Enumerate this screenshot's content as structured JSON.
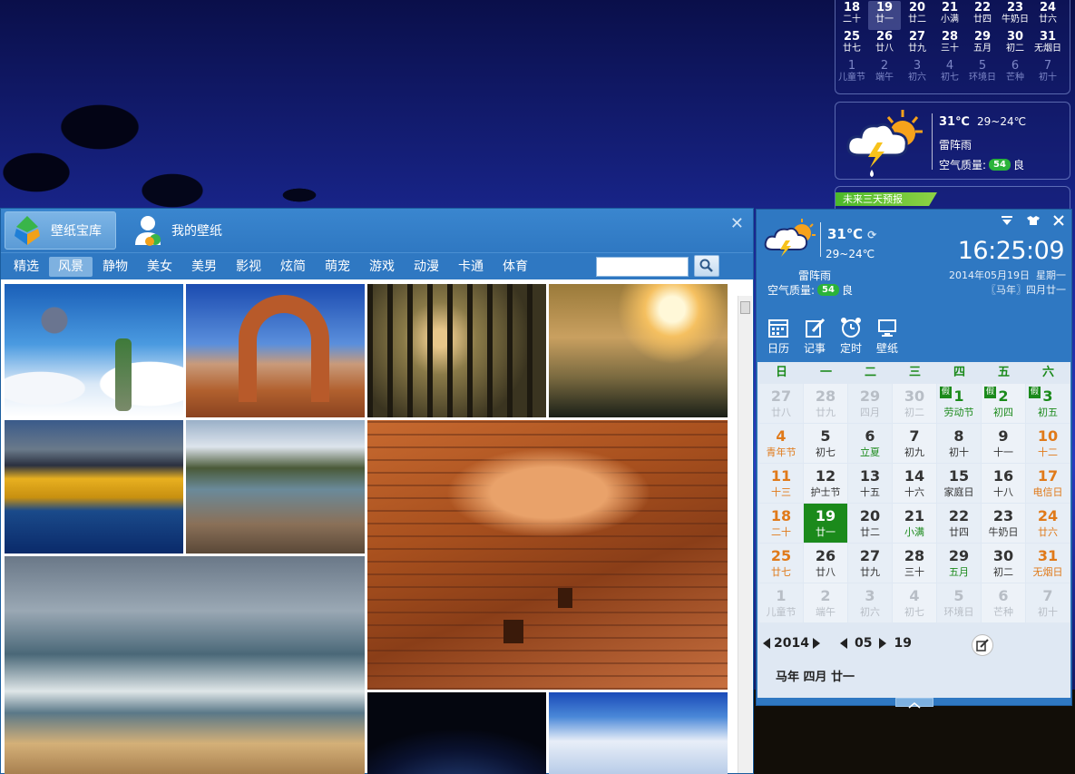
{
  "desktop_calendar": {
    "rows": [
      [
        {
          "n": "18",
          "s": "二十"
        },
        {
          "n": "19",
          "s": "廿一",
          "today": true
        },
        {
          "n": "20",
          "s": "廿二"
        },
        {
          "n": "21",
          "s": "小满"
        },
        {
          "n": "22",
          "s": "廿四"
        },
        {
          "n": "23",
          "s": "牛奶日"
        },
        {
          "n": "24",
          "s": "廿六"
        }
      ],
      [
        {
          "n": "25",
          "s": "廿七"
        },
        {
          "n": "26",
          "s": "廿八"
        },
        {
          "n": "27",
          "s": "廿九"
        },
        {
          "n": "28",
          "s": "三十"
        },
        {
          "n": "29",
          "s": "五月"
        },
        {
          "n": "30",
          "s": "初二"
        },
        {
          "n": "31",
          "s": "无烟日"
        }
      ],
      [
        {
          "n": "1",
          "s": "儿童节",
          "muted": true
        },
        {
          "n": "2",
          "s": "端午",
          "muted": true
        },
        {
          "n": "3",
          "s": "初六",
          "muted": true
        },
        {
          "n": "4",
          "s": "初七",
          "muted": true
        },
        {
          "n": "5",
          "s": "环境日",
          "muted": true
        },
        {
          "n": "6",
          "s": "芒种",
          "muted": true
        },
        {
          "n": "7",
          "s": "初十",
          "muted": true
        }
      ]
    ]
  },
  "desktop_weather": {
    "temp": "31℃",
    "range": "29~24℃",
    "condition": "雷阵雨",
    "aq_label": "空气质量:",
    "aqi": "54",
    "aq_level": "良"
  },
  "desktop_forecast": {
    "label": "未来三天预报"
  },
  "wallpaper": {
    "tab_library": "壁纸宝库",
    "tab_mine": "我的壁纸",
    "categories": [
      "精选",
      "风景",
      "静物",
      "美女",
      "美男",
      "影视",
      "炫简",
      "萌宠",
      "游戏",
      "动漫",
      "卡通",
      "体育"
    ],
    "selected_category": "风景",
    "search_value": ""
  },
  "calendar": {
    "temp": "31℃",
    "range": "29~24℃",
    "clock": "16:25:09",
    "condition": "雷阵雨",
    "aq_label": "空气质量:",
    "aqi": "54",
    "aq_level": "良",
    "date": "2014年05月19日",
    "weekday": "星期一",
    "lunar": "〖马年〗四月廿一",
    "tools": [
      "日历",
      "记事",
      "定时",
      "壁纸"
    ],
    "weekdays": [
      "日",
      "一",
      "二",
      "三",
      "四",
      "五",
      "六"
    ],
    "year": "2014",
    "month": "05",
    "day": "19",
    "lunar_line": "马年 四月 廿一",
    "holiday_mark": "假",
    "colors": {
      "accent": "#2f78c2",
      "today": "#1b8a1b",
      "weekend": "#e07a1a"
    },
    "weeks": [
      [
        {
          "n": "27",
          "s": "廿八",
          "m": 1
        },
        {
          "n": "28",
          "s": "廿九",
          "m": 1
        },
        {
          "n": "29",
          "s": "四月",
          "m": 1
        },
        {
          "n": "30",
          "s": "初二",
          "m": 1
        },
        {
          "n": "1",
          "s": "劳动节",
          "h": 1
        },
        {
          "n": "2",
          "s": "初四",
          "h": 1
        },
        {
          "n": "3",
          "s": "初五",
          "h": 1
        }
      ],
      [
        {
          "n": "4",
          "s": "青年节",
          "w": 1
        },
        {
          "n": "5",
          "s": "初七"
        },
        {
          "n": "6",
          "s": "立夏",
          "f": 1
        },
        {
          "n": "7",
          "s": "初九"
        },
        {
          "n": "8",
          "s": "初十"
        },
        {
          "n": "9",
          "s": "十一"
        },
        {
          "n": "10",
          "s": "十二",
          "w": 1
        }
      ],
      [
        {
          "n": "11",
          "s": "十三",
          "w": 1
        },
        {
          "n": "12",
          "s": "护士节"
        },
        {
          "n": "13",
          "s": "十五"
        },
        {
          "n": "14",
          "s": "十六"
        },
        {
          "n": "15",
          "s": "家庭日"
        },
        {
          "n": "16",
          "s": "十八"
        },
        {
          "n": "17",
          "s": "电信日",
          "w": 1
        }
      ],
      [
        {
          "n": "18",
          "s": "二十",
          "w": 1
        },
        {
          "n": "19",
          "s": "廿一",
          "t": 1
        },
        {
          "n": "20",
          "s": "廿二"
        },
        {
          "n": "21",
          "s": "小满",
          "f": 1
        },
        {
          "n": "22",
          "s": "廿四"
        },
        {
          "n": "23",
          "s": "牛奶日"
        },
        {
          "n": "24",
          "s": "廿六",
          "w": 1
        }
      ],
      [
        {
          "n": "25",
          "s": "廿七",
          "w": 1
        },
        {
          "n": "26",
          "s": "廿八"
        },
        {
          "n": "27",
          "s": "廿九"
        },
        {
          "n": "28",
          "s": "三十"
        },
        {
          "n": "29",
          "s": "五月",
          "f": 1
        },
        {
          "n": "30",
          "s": "初二"
        },
        {
          "n": "31",
          "s": "无烟日",
          "w": 1
        }
      ],
      [
        {
          "n": "1",
          "s": "儿童节",
          "m": 1
        },
        {
          "n": "2",
          "s": "端午",
          "m": 1
        },
        {
          "n": "3",
          "s": "初六",
          "m": 1
        },
        {
          "n": "4",
          "s": "初七",
          "m": 1
        },
        {
          "n": "5",
          "s": "环境日",
          "m": 1
        },
        {
          "n": "6",
          "s": "芒种",
          "m": 1
        },
        {
          "n": "7",
          "s": "初十",
          "m": 1
        }
      ]
    ]
  },
  "thumbnails": [
    {
      "name": "floating-island"
    },
    {
      "name": "desert-arch"
    },
    {
      "name": "misty-forest"
    },
    {
      "name": "sunset-mist"
    },
    {
      "name": "autumn-lake"
    },
    {
      "name": "mountain-river"
    },
    {
      "name": "canyon-ruins"
    },
    {
      "name": "ocean-beach"
    },
    {
      "name": "night-sky"
    },
    {
      "name": "clouds-aerial"
    }
  ]
}
